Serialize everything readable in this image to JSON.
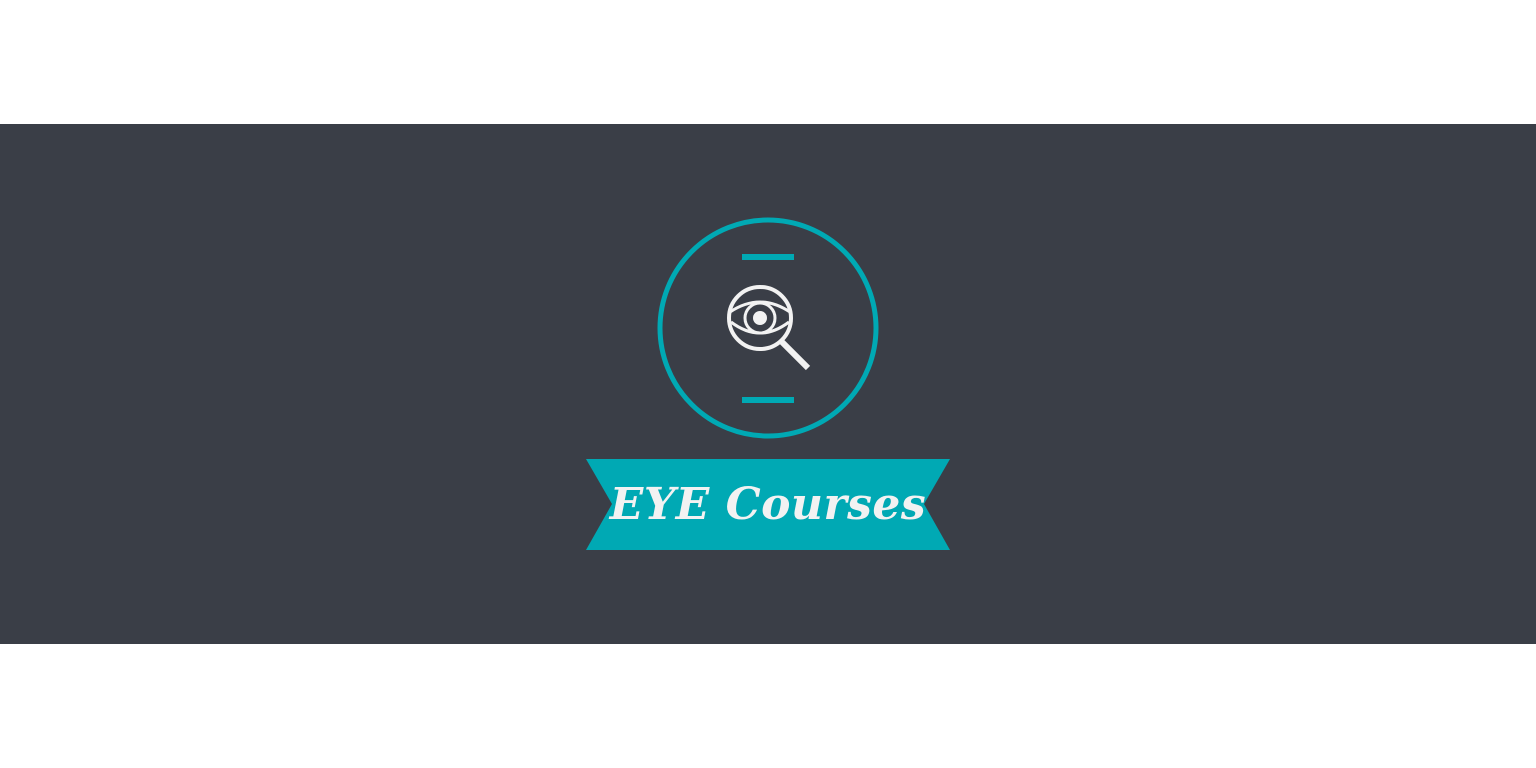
{
  "banner": {
    "title": "EYE Courses"
  },
  "emblem": {
    "icon": "eye-magnifier-icon"
  },
  "colors": {
    "background": "#ffffff",
    "band": "#3a3e47",
    "accent": "#00a9b4",
    "icon": "#f2f2f2"
  }
}
